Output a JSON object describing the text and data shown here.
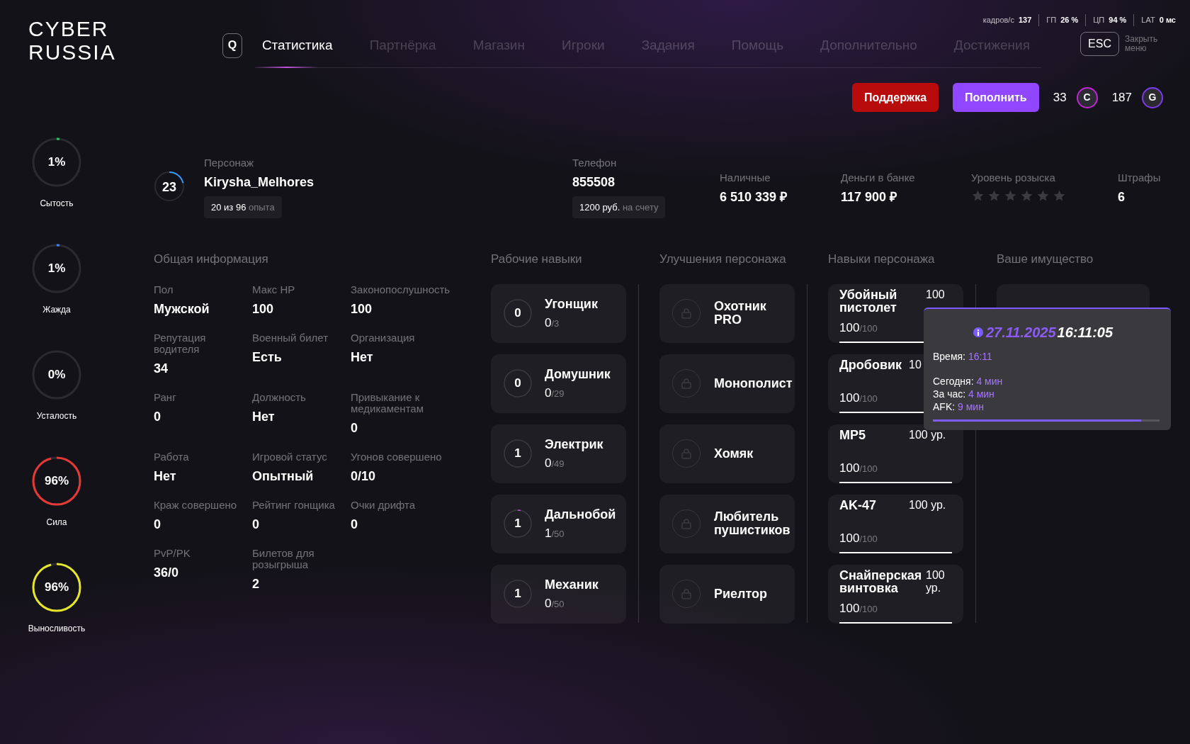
{
  "logo": [
    "CYBER",
    "RUSSIA"
  ],
  "search_key": "Q",
  "tabs": [
    {
      "label": "Статистика",
      "selected": true
    },
    {
      "label": "Партнёрка",
      "selected": false
    },
    {
      "label": "Магазин",
      "selected": false
    },
    {
      "label": "Игроки",
      "selected": false
    },
    {
      "label": "Задания",
      "selected": false
    },
    {
      "label": "Помощь",
      "selected": false
    },
    {
      "label": "Дополнительно",
      "selected": false
    },
    {
      "label": "Достижения",
      "selected": false
    }
  ],
  "perf": [
    {
      "label": "кадров/с",
      "value": "137"
    },
    {
      "label": "ГП",
      "value": "26 %"
    },
    {
      "label": "ЦП",
      "value": "94 %"
    },
    {
      "label": "LAT",
      "value": "0 мс"
    }
  ],
  "close": {
    "key": "ESC",
    "label": "Закрыть меню"
  },
  "actions": [
    {
      "label": "Поддержка",
      "kind": "support"
    },
    {
      "label": "Пополнить",
      "kind": "topup"
    }
  ],
  "currencies": [
    {
      "amount": "33",
      "symbol": "C",
      "color": "#c026d3"
    },
    {
      "amount": "187",
      "symbol": "G",
      "color": "#7c3aed"
    }
  ],
  "needs": [
    {
      "label": "Сытость",
      "reading": "1%",
      "level": 0.01,
      "color": "#22c55e"
    },
    {
      "label": "Жажда",
      "reading": "1%",
      "level": 0.01,
      "color": "#3b82f6"
    },
    {
      "label": "Усталость",
      "reading": "0%",
      "level": 0
    },
    {
      "label": "Сила",
      "reading": "96%",
      "level": 0.96,
      "color": "#e53935"
    },
    {
      "label": "Выносливость",
      "reading": "96%",
      "level": 0.96,
      "color": "#e5e52b"
    }
  ],
  "character": {
    "level_number": "23",
    "level": 0.21,
    "label": "Персонаж",
    "name": "Kirysha_Melhores",
    "exp_value": "20 из 96",
    "exp_unit": "опыта"
  },
  "phone": {
    "label": "Телефон",
    "number": "855508",
    "balance": "1200 руб.",
    "balance_note": "на счету"
  },
  "money": [
    {
      "label": "Наличные",
      "value": "6 510 339 ₽"
    },
    {
      "label": "Деньги в банке",
      "value": "117 900 ₽"
    }
  ],
  "wanted": {
    "label": "Уровень розыска",
    "stars": 0
  },
  "fines": {
    "label": "Штрафы",
    "value": "6"
  },
  "general": {
    "title": "Общая информация",
    "fields": [
      {
        "label": "Пол",
        "value": "Мужской"
      },
      {
        "label": "Макс HP",
        "value": "100"
      },
      {
        "label": "Законопослушность",
        "value": "100"
      },
      {
        "label": "Репутация водителя",
        "value": "34"
      },
      {
        "label": "Военный билет",
        "value": "Есть"
      },
      {
        "label": "Организация",
        "value": "Нет"
      },
      {
        "label": "Ранг",
        "value": "0"
      },
      {
        "label": "Должность",
        "value": "Нет"
      },
      {
        "label": "Привыкание к медикаментам",
        "value": "0"
      },
      {
        "label": "Работа",
        "value": "Нет"
      },
      {
        "label": "Игровой статус",
        "value": "Опытный"
      },
      {
        "label": "Угонов совершено",
        "value": "0/10"
      },
      {
        "label": "Краж совершено",
        "value": "0"
      },
      {
        "label": "Рейтинг гонщика",
        "value": "0"
      },
      {
        "label": "Очки дрифта",
        "value": "0"
      },
      {
        "label": "PvP/PK",
        "value": "36/0"
      },
      {
        "label": "Билетов для розыгрыша",
        "value": "2"
      }
    ]
  },
  "work_skills": {
    "title": "Рабочие навыки",
    "items": [
      {
        "rank": "0",
        "name": "Угонщик",
        "progress": "0",
        "max": "/3",
        "level": 0
      },
      {
        "rank": "0",
        "name": "Домушник",
        "progress": "0",
        "max": "/29",
        "level": 0
      },
      {
        "rank": "1",
        "name": "Электрик",
        "progress": "0",
        "max": "/49",
        "level": 0
      },
      {
        "rank": "1",
        "name": "Дальнобой",
        "progress": "1",
        "max": "/50",
        "level": 0.02
      },
      {
        "rank": "1",
        "name": "Механик",
        "progress": "0",
        "max": "/50",
        "level": 0
      }
    ]
  },
  "upgrades": {
    "title": "Улучшения персонажа",
    "items": [
      {
        "name": "Охотник PRO",
        "locked": true
      },
      {
        "name": "Монополист",
        "locked": true
      },
      {
        "name": "Хомяк",
        "locked": true
      },
      {
        "name": "Любитель пушистиков",
        "locked": true
      },
      {
        "name": "Риелтор",
        "locked": true
      }
    ]
  },
  "char_skills": {
    "title": "Навыки персонажа",
    "items": [
      {
        "name": "Убойный пистолет",
        "grade": "100",
        "progress": "100",
        "max": "/100",
        "level": 1
      },
      {
        "name": "Дробовик",
        "grade": "10",
        "progress": "100",
        "max": "/100",
        "level": 1
      },
      {
        "name": "MP5",
        "grade": "100 ур.",
        "progress": "100",
        "max": "/100",
        "level": 1
      },
      {
        "name": "AK-47",
        "grade": "100 ур.",
        "progress": "100",
        "max": "/100",
        "level": 1
      },
      {
        "name": "Снайперская винтовка",
        "grade": "100 ур.",
        "progress": "100",
        "max": "/100",
        "level": 1
      }
    ]
  },
  "property": {
    "title": "Ваше имущество"
  },
  "tooltip": {
    "date": "27.11.2025",
    "time": "16:11:05",
    "time_row": {
      "label": "Время:",
      "value": "16:11"
    },
    "rows": [
      {
        "label": "Сегодня:",
        "value": "4 мин"
      },
      {
        "label": "За час:",
        "value": "4 мин"
      },
      {
        "label": "AFK:",
        "value": "9 мин"
      }
    ],
    "level": 0.92
  }
}
